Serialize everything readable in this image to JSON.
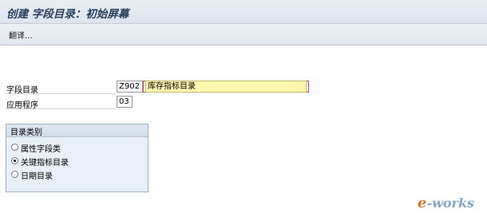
{
  "window": {
    "title": "创建 字段目录：初始屏幕"
  },
  "toolbar": {
    "translate_label": "翻译..."
  },
  "form": {
    "catalog_label": "字段目录",
    "catalog_value": "Z902",
    "catalog_desc": "库存指标目录",
    "app_label": "应用程序",
    "app_value": "03"
  },
  "catalog_type": {
    "title": "目录类别",
    "options": [
      {
        "label": "属性字段类",
        "selected": false
      },
      {
        "label": "关键指标目录",
        "selected": true
      },
      {
        "label": "日期目录",
        "selected": false
      }
    ]
  },
  "watermark": {
    "prefix": "e",
    "text": "-works"
  }
}
